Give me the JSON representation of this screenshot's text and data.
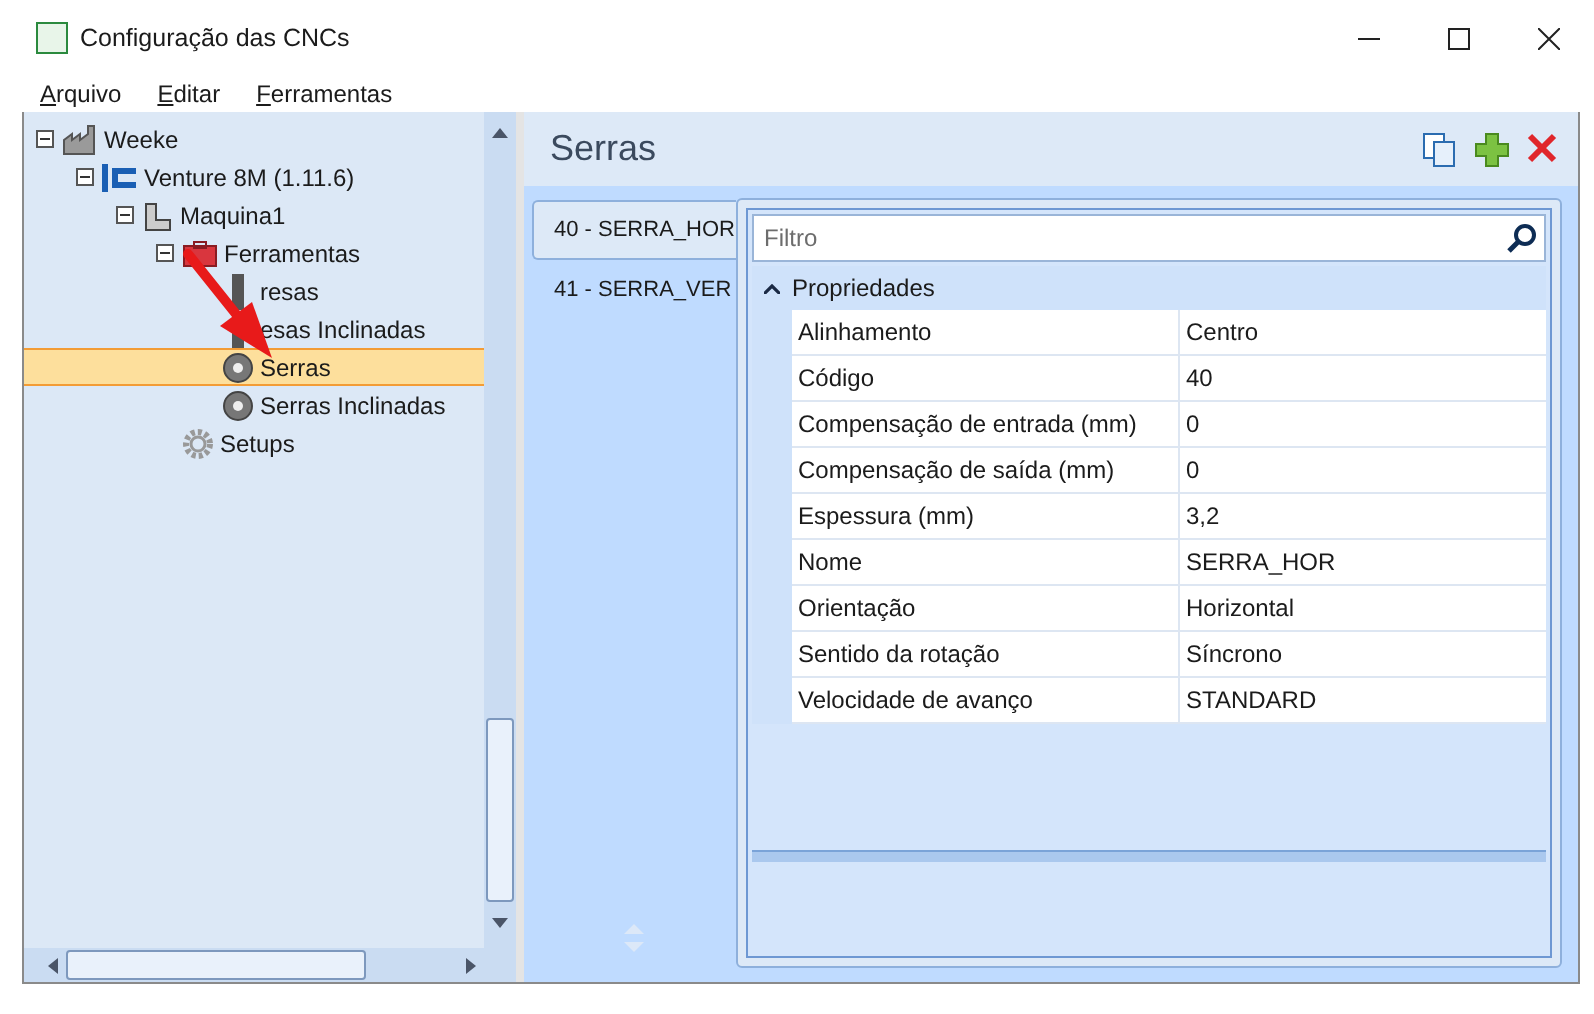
{
  "window": {
    "title": "Configuração das CNCs"
  },
  "menu": [
    {
      "label": "Arquivo"
    },
    {
      "label": "Editar"
    },
    {
      "label": "Ferramentas"
    }
  ],
  "tree": [
    {
      "label": "Weeke",
      "kind": "factory",
      "expanded": true,
      "selected": false,
      "children": [
        {
          "label": "Venture 8M (1.11.6)",
          "kind": "series",
          "expanded": true,
          "selected": false,
          "children": [
            {
              "label": "Maquina1",
              "kind": "machine",
              "expanded": true,
              "selected": false,
              "children": [
                {
                  "label": "Ferramentas",
                  "kind": "toolbox",
                  "expanded": true,
                  "selected": false,
                  "children": [
                    {
                      "label": "resas",
                      "kind": "tool",
                      "selected": false
                    },
                    {
                      "label": "esas Inclinadas",
                      "kind": "tool",
                      "selected": false
                    },
                    {
                      "label": "Serras",
                      "kind": "blade",
                      "selected": true
                    },
                    {
                      "label": "Serras Inclinadas",
                      "kind": "blade",
                      "selected": false
                    }
                  ]
                },
                {
                  "label": "Setups",
                  "kind": "gear",
                  "selected": false
                }
              ]
            }
          ]
        }
      ]
    }
  ],
  "panel": {
    "title": "Serras"
  },
  "tabs": [
    {
      "label": "40 - SERRA_HOR",
      "selected": true
    },
    {
      "label": "41 - SERRA_VER",
      "selected": false
    }
  ],
  "filter": {
    "placeholder": "Filtro"
  },
  "category": {
    "label": "Propriedades",
    "expanded": true
  },
  "properties": [
    {
      "name": "Alinhamento",
      "value": "Centro"
    },
    {
      "name": "Código",
      "value": "40"
    },
    {
      "name": "Compensação de entrada (mm)",
      "value": "0"
    },
    {
      "name": "Compensação de saída (mm)",
      "value": "0"
    },
    {
      "name": "Espessura (mm)",
      "value": "3,2"
    },
    {
      "name": "Nome",
      "value": "SERRA_HOR"
    },
    {
      "name": "Orientação",
      "value": "Horizontal"
    },
    {
      "name": "Sentido da rotação",
      "value": "Síncrono"
    },
    {
      "name": "Velocidade de avanço",
      "value": "STANDARD"
    }
  ]
}
